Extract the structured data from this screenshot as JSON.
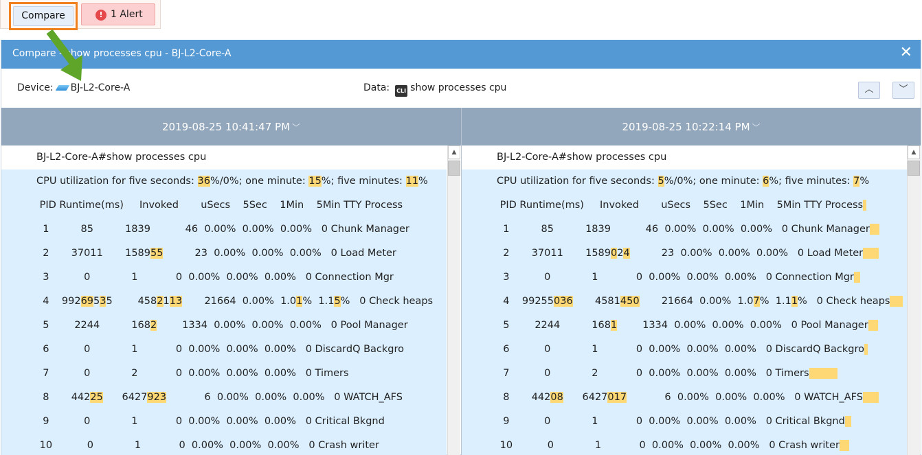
{
  "toolbar": {
    "compare_label": "Compare",
    "alert_label": "1 Alert",
    "alert_icon": "exclamation-icon"
  },
  "dialog": {
    "title": "Compare - show processes cpu - BJ-L2-Core-A",
    "device_label": "Device:",
    "device_name": "BJ-L2-Core-A",
    "data_label": "Data:",
    "data_value": "show processes cpu",
    "cli_icon_text": "CLI"
  },
  "colors": {
    "titlebar": "#5499d3",
    "highlight": "#fdd874",
    "row_bg": "#dcefff",
    "header": "#92a7bc",
    "focus": "#f07f1e",
    "arrow": "#5fa52a"
  },
  "panes": [
    {
      "timestamp": "2019-08-25 10:41:47 PM",
      "lines": [
        [
          [
            "BJ-L2-Core-A#show processes cpu",
            0
          ]
        ],
        [
          [
            "CPU utilization for five seconds: ",
            0
          ],
          [
            "36",
            1
          ],
          [
            "%/0%; one minute: ",
            0
          ],
          [
            "15",
            1
          ],
          [
            "%; five minutes: ",
            0
          ],
          [
            "11",
            1
          ],
          [
            "%",
            0
          ]
        ],
        [
          [
            " PID Runtime(ms)     Invoked       uSecs    5Sec    1Min    5Min TTY Process",
            0
          ]
        ],
        [
          [
            "  1          85          1839           46  0.00%  0.00%  0.00%   0 Chunk Manager",
            0
          ]
        ],
        [
          [
            "  2       37011       1589",
            0
          ],
          [
            "55",
            1
          ],
          [
            "          23  0.00%  0.00%  0.00%   0 Load Meter",
            0
          ]
        ],
        [
          [
            "  3           0             1            0  0.00%  0.00%  0.00%   0 Connection Mgr",
            0
          ]
        ],
        [
          [
            "  4    992",
            0
          ],
          [
            "69",
            1
          ],
          [
            "5",
            0
          ],
          [
            "3",
            1
          ],
          [
            "5        458",
            0
          ],
          [
            "2",
            1
          ],
          [
            "1",
            0
          ],
          [
            "13",
            1
          ],
          [
            "       21664  0.00%  1.0",
            0
          ],
          [
            "1",
            1
          ],
          [
            "%  1.1",
            0
          ],
          [
            "5",
            1
          ],
          [
            "%   0 Check heaps",
            0
          ]
        ],
        [
          [
            "  5        2244          168",
            0
          ],
          [
            "2",
            1
          ],
          [
            "        1334  0.00%  0.00%  0.00%   0 Pool Manager",
            0
          ]
        ],
        [
          [
            "  6           0             1            0  0.00%  0.00%  0.00%   0 DiscardQ Backgro",
            0
          ]
        ],
        [
          [
            "  7           0             2            0  0.00%  0.00%  0.00%   0 Timers",
            0
          ]
        ],
        [
          [
            "  8       442",
            0
          ],
          [
            "25",
            1
          ],
          [
            "      6427",
            0
          ],
          [
            "923",
            1
          ],
          [
            "            6  0.00%  0.00%  0.00%   0 WATCH_AFS",
            0
          ]
        ],
        [
          [
            "  9           0             1            0  0.00%  0.00%  0.00%   0 Critical Bkgnd",
            0
          ]
        ],
        [
          [
            " 10           0             1            0  0.00%  0.00%  0.00%   0 Crash writer",
            0
          ]
        ]
      ]
    },
    {
      "timestamp": "2019-08-25 10:22:14 PM",
      "lines": [
        [
          [
            "BJ-L2-Core-A#show processes cpu",
            0
          ]
        ],
        [
          [
            "CPU utilization for five seconds: ",
            0
          ],
          [
            "5",
            1
          ],
          [
            "%/0%; one minute: ",
            0
          ],
          [
            "6",
            1
          ],
          [
            "%; five minutes: ",
            0
          ],
          [
            "7",
            1
          ],
          [
            "%",
            0
          ]
        ],
        [
          [
            " PID Runtime(ms)     Invoked       uSecs    5Sec    1Min    5Min TTY Process",
            0
          ],
          [
            " ",
            1
          ]
        ],
        [
          [
            "  1          85          1839           46  0.00%  0.00%  0.00%   0 Chunk Manager",
            0
          ],
          [
            "   ",
            1
          ]
        ],
        [
          [
            "  2       37011       1589",
            0
          ],
          [
            "0",
            1
          ],
          [
            "2",
            0
          ],
          [
            "4",
            1
          ],
          [
            "          23  0.00%  0.00%  0.00%   0 Load Meter",
            0
          ],
          [
            "     ",
            1
          ]
        ],
        [
          [
            "  3           0             1            0  0.00%  0.00%  0.00%   0 Connection Mgr",
            0
          ],
          [
            "  ",
            1
          ]
        ],
        [
          [
            "  4    99255",
            0
          ],
          [
            "036",
            1
          ],
          [
            "       4581",
            0
          ],
          [
            "450",
            1
          ],
          [
            "       21664  0.00%  1.0",
            0
          ],
          [
            "7",
            1
          ],
          [
            "%  1.1",
            0
          ],
          [
            "1",
            1
          ],
          [
            "%   0 Check heaps",
            0
          ],
          [
            "    ",
            1
          ]
        ],
        [
          [
            "  5        2244          168",
            0
          ],
          [
            "1",
            1
          ],
          [
            "        1334  0.00%  0.00%  0.00%   0 Pool Manager",
            0
          ],
          [
            "   ",
            1
          ]
        ],
        [
          [
            "  6           0             1            0  0.00%  0.00%  0.00%   0 DiscardQ Backgro",
            0
          ],
          [
            " ",
            1
          ]
        ],
        [
          [
            "  7           0             2            0  0.00%  0.00%  0.00%   0 Timers",
            0
          ],
          [
            "         ",
            1
          ]
        ],
        [
          [
            "  8       442",
            0
          ],
          [
            "08",
            1
          ],
          [
            "      6427",
            0
          ],
          [
            "017",
            1
          ],
          [
            "            6  0.00%  0.00%  0.00%   0 WATCH_AFS",
            0
          ],
          [
            "     ",
            1
          ]
        ],
        [
          [
            "  9           0             1            0  0.00%  0.00%  0.00%   0 Critical Bkgnd",
            0
          ],
          [
            "  ",
            1
          ]
        ],
        [
          [
            " 10           0             1            0  0.00%  0.00%  0.00%   0 Crash writer",
            0
          ],
          [
            "   ",
            1
          ]
        ]
      ]
    }
  ]
}
